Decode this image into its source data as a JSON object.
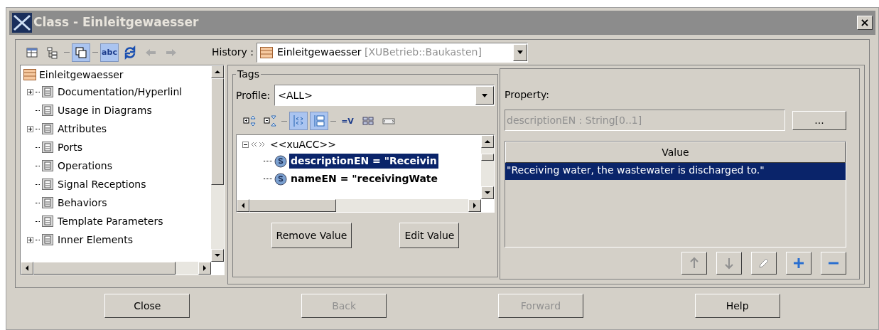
{
  "window": {
    "title": "Class - Einleitgewaesser",
    "close": "×"
  },
  "toolbar": [
    {
      "kind": "table",
      "selected": false
    },
    {
      "kind": "tree",
      "selected": false
    },
    {
      "kind": "sep"
    },
    {
      "kind": "windows",
      "selected": true
    },
    {
      "kind": "sep"
    },
    {
      "kind": "abc",
      "selected": true,
      "label": "abc"
    },
    {
      "kind": "refresh",
      "selected": false
    },
    {
      "kind": "back",
      "selected": false
    },
    {
      "kind": "forward",
      "selected": false
    }
  ],
  "history": {
    "label": "History :",
    "name": "Einleitgewaesser",
    "qualifier": "[XUBetrieb::Baukasten]"
  },
  "tree": {
    "root": "Einleitgewaesser",
    "items": [
      {
        "label": "Documentation/Hyperlinl",
        "expandable": true
      },
      {
        "label": "Usage in Diagrams",
        "expandable": false
      },
      {
        "label": "Attributes",
        "expandable": true
      },
      {
        "label": "Ports",
        "expandable": false
      },
      {
        "label": "Operations",
        "expandable": false
      },
      {
        "label": "Signal Receptions",
        "expandable": false
      },
      {
        "label": "Behaviors",
        "expandable": false
      },
      {
        "label": "Template Parameters",
        "expandable": false
      },
      {
        "label": "Inner Elements",
        "expandable": true
      }
    ]
  },
  "tags": {
    "legend": "Tags",
    "profile_label": "Profile:",
    "profile_value": "<ALL>",
    "tools": [
      {
        "kind": "expand",
        "selected": false
      },
      {
        "kind": "collapse",
        "selected": false
      },
      {
        "kind": "sep"
      },
      {
        "kind": "stereo",
        "selected": true
      },
      {
        "kind": "folders",
        "selected": true
      },
      {
        "kind": "sep"
      },
      {
        "kind": "eqv",
        "selected": false,
        "label": "=V"
      },
      {
        "kind": "grid",
        "selected": false
      },
      {
        "kind": "tagbox",
        "selected": false
      }
    ],
    "stereotype": {
      "label": "<<xuACC>>",
      "expanded": true,
      "children": [
        {
          "label": "descriptionEN = \"Receivin",
          "selected": true
        },
        {
          "label": "nameEN = \"receivingWate",
          "selected": false
        }
      ]
    },
    "buttons": [
      "Remove Value",
      "Edit Value"
    ]
  },
  "property": {
    "label": "Property:",
    "value": "descriptionEN : String[0..1]",
    "browse": "...",
    "column": "Value",
    "rows": [
      {
        "text": "\"Receiving water, the wastewater is discharged to.\"",
        "selected": true
      }
    ],
    "actions": [
      {
        "kind": "up",
        "disabled": true
      },
      {
        "kind": "down",
        "disabled": true
      },
      {
        "kind": "edit",
        "disabled": true
      },
      {
        "kind": "add",
        "disabled": false
      },
      {
        "kind": "remove",
        "disabled": false
      }
    ]
  },
  "footer": [
    {
      "label": "Close",
      "disabled": false
    },
    {
      "label": "Back",
      "disabled": true
    },
    {
      "label": "Forward",
      "disabled": true
    },
    {
      "label": "Help",
      "disabled": false
    }
  ]
}
